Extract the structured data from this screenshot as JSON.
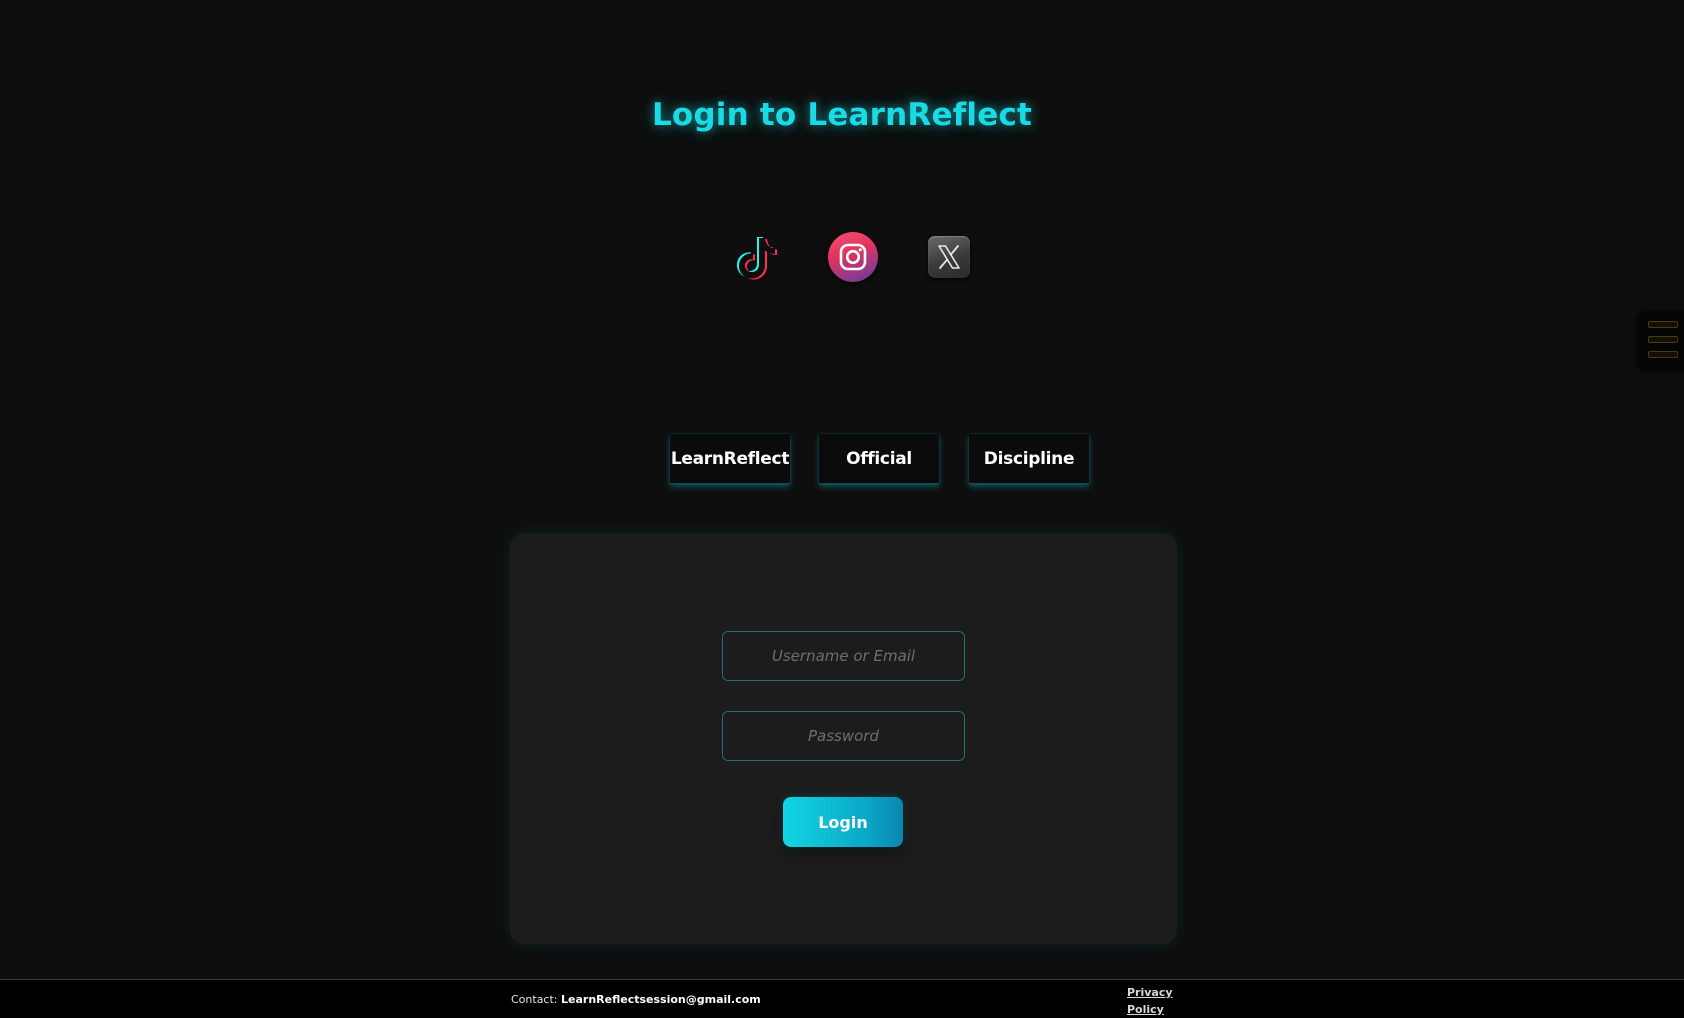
{
  "page": {
    "title": "Login to LearnReflect"
  },
  "social": [
    {
      "icon": "tiktok-icon"
    },
    {
      "icon": "instagram-icon"
    },
    {
      "icon": "x-icon"
    }
  ],
  "tags": [
    {
      "label": "LearnReflect"
    },
    {
      "label": "Official"
    },
    {
      "label": "Discipline"
    }
  ],
  "login_form": {
    "username_placeholder": "Username or Email",
    "username_value": "",
    "password_placeholder": "Password",
    "password_value": "",
    "submit_label": "Login"
  },
  "footer": {
    "contact_label": "Contact:",
    "contact_email": "LearnReflectsession@gmail.com",
    "privacy_label": "Privacy Policy"
  },
  "colors": {
    "background": "#0e0e0e",
    "accent": "#19dbe6",
    "panel": "#1c1c1c",
    "footer": "#000000"
  }
}
